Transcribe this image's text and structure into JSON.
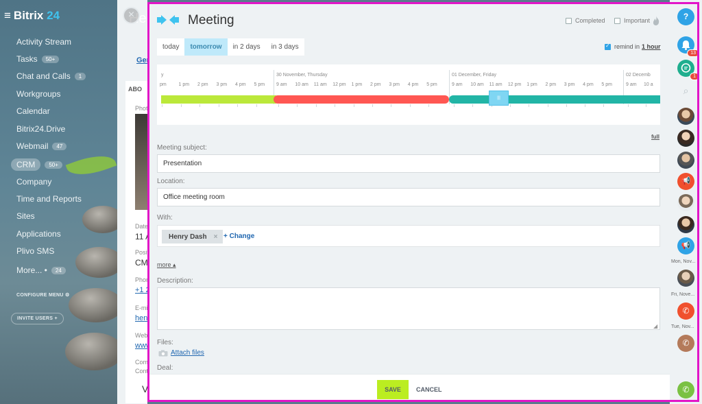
{
  "sidebar": {
    "logo_main": "Bitrix",
    "logo_accent": "24",
    "items": [
      {
        "label": "Activity Stream",
        "badge": ""
      },
      {
        "label": "Tasks",
        "badge": "50+"
      },
      {
        "label": "Chat and Calls",
        "badge": "1"
      },
      {
        "label": "Workgroups",
        "badge": ""
      },
      {
        "label": "Calendar",
        "badge": ""
      },
      {
        "label": "Bitrix24.Drive",
        "badge": ""
      },
      {
        "label": "Webmail",
        "badge": "47"
      },
      {
        "label": "CRM",
        "badge": "50+"
      },
      {
        "label": "Company",
        "badge": ""
      },
      {
        "label": "Time and Reports",
        "badge": ""
      },
      {
        "label": "Sites",
        "badge": ""
      },
      {
        "label": "Applications",
        "badge": ""
      },
      {
        "label": "Plivo SMS",
        "badge": ""
      },
      {
        "label": "More... •",
        "badge": "24"
      }
    ],
    "configure_menu": "CONFIGURE MENU",
    "invite_users": "INVITE USERS"
  },
  "background_page": {
    "title_fragment": "He",
    "tab_fragment": "Ger",
    "about_fragment": "ABO",
    "photo_fragment": "Phot",
    "date_fragment": "Date",
    "date_value": "11 A",
    "position_fragment": "Posit",
    "position_value": "CMO",
    "phone_fragment": "Phon",
    "phone_value": "+1 2",
    "email_fragment": "E-mi",
    "email_value": "hen",
    "web_fragment": "Web",
    "web_value": "www",
    "comment_fragment": "Com",
    "contact_fragment": "Cont",
    "bottom_fragment": "V"
  },
  "modal": {
    "title": "Meeting",
    "completed_label": "Completed",
    "important_label": "Important",
    "date_tabs": [
      "today",
      "tomorrow",
      "in 2 days",
      "in 3 days"
    ],
    "remind_label": "remind in",
    "remind_value": "1 hour",
    "timeline": {
      "day_labels": [
        "y",
        "30 November, Thursday",
        "01 December, Friday",
        "02 Decemb"
      ],
      "hours_segment_1": [
        "pm",
        "1 pm",
        "2 pm",
        "3 pm",
        "4 pm",
        "5 pm"
      ],
      "hours_segment_2": [
        "9 am",
        "10 am",
        "11 am",
        "12 pm",
        "1 pm",
        "2 pm",
        "3 pm",
        "4 pm",
        "5 pm"
      ],
      "hours_segment_3": [
        "9 am",
        "10 am",
        "11 am",
        "12 pm",
        "1 pm",
        "2 pm",
        "3 pm",
        "4 pm",
        "5 pm"
      ],
      "hours_segment_4": [
        "9 am",
        "10 a"
      ],
      "handle_glyph": "|||"
    },
    "full_link": "full",
    "subject_label": "Meeting subject:",
    "subject_value": "Presentation",
    "location_label": "Location:",
    "location_value": "Office meeting room",
    "with_label": "With:",
    "person_name": "Henry Dash",
    "remove_glyph": "×",
    "change_link": "+ Change",
    "more_link": "more",
    "more_glyph": "▴",
    "description_label": "Description:",
    "description_value": "",
    "files_label": "Files:",
    "attach_link": "Attach files",
    "deal_label": "Deal:",
    "save_label": "SAVE",
    "cancel_label": "CANCEL"
  },
  "right_panel": {
    "help_glyph": "?",
    "notifications_badge": "13",
    "chat_badge": "1",
    "date_labels": [
      "Mon, Nov...",
      "Fri, Nove...",
      "Tue, Nov..."
    ]
  },
  "colors": {
    "accent_blue": "#3fc3ef",
    "bar_green": "#bbe83a",
    "bar_red": "#ff5752",
    "bar_teal": "#22b5a6",
    "save_green": "#bbed21",
    "highlight_magenta": "#e215c8"
  }
}
